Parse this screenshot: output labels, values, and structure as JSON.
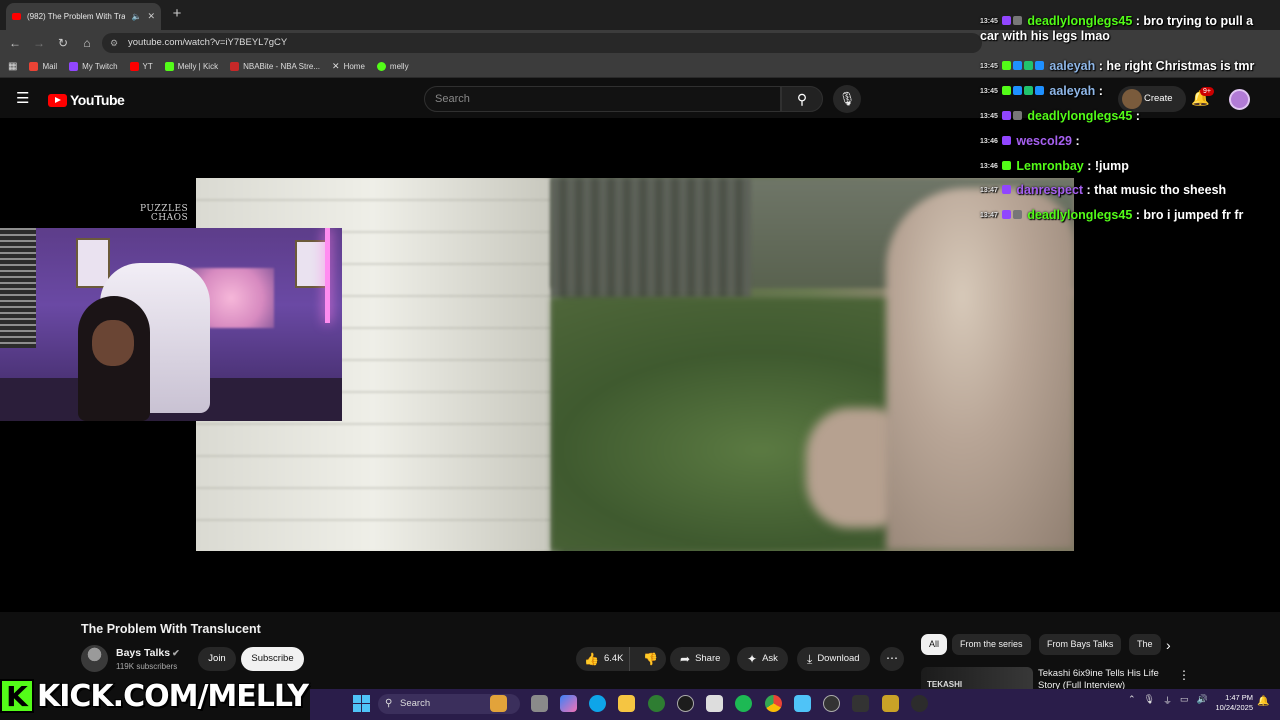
{
  "browser": {
    "tab_title": "(982) The Problem With Tra",
    "tab_muted_icon": "speaker-icon",
    "url": "youtube.com/watch?v=iY7BEYL7gCY",
    "bookmarks": [
      "Mail",
      "My Twitch",
      "YT",
      "Melly | Kick",
      "NBABite - NBA Stre...",
      "Home",
      "melly"
    ]
  },
  "youtube": {
    "logo": "YouTube",
    "search_placeholder": "Search",
    "create_label": "Create",
    "notif_badge": "9+"
  },
  "player": {
    "overlay_logo": "PUZZLES\nCHAOS"
  },
  "video": {
    "title": "The Problem With Translucent",
    "channel": "Bays Talks",
    "verified": "✔",
    "subscribers": "119K subscribers",
    "join_label": "Join",
    "subscribe_label": "Subscribe",
    "likes": "6.4K",
    "share_label": "Share",
    "ask_label": "Ask",
    "download_label": "Download"
  },
  "chips": [
    "All",
    "From the series",
    "From Bays Talks",
    "The"
  ],
  "recommendation": {
    "thumb_text": "TEKASHI",
    "title": "Tekashi 6ix9ine Tells His Life Story (Full Interview)"
  },
  "chat": [
    {
      "time": "13:45",
      "badges": [
        "twitch",
        "mute"
      ],
      "user": "deadlylonglegs45",
      "user_color": "#53fc18",
      "text": " : bro trying to pull a car with his legs lmao"
    },
    {
      "time": "13:45",
      "badges": [
        "kick",
        "blue",
        "green",
        "blue"
      ],
      "user": "aaleyah",
      "user_color": "#8fb7e8",
      "text": " : he right Christmas is tmr"
    },
    {
      "time": "13:45",
      "badges": [
        "kick",
        "blue",
        "green",
        "blue"
      ],
      "user": "aaleyah",
      "user_color": "#8fb7e8",
      "text": " :"
    },
    {
      "time": "13:45",
      "badges": [
        "twitch",
        "mute"
      ],
      "user": "deadlylonglegs45",
      "user_color": "#53fc18",
      "text": " :"
    },
    {
      "time": "13:46",
      "badges": [
        "twitch"
      ],
      "user": "wescol29",
      "user_color": "#a660f0",
      "text": " :"
    },
    {
      "time": "13:46",
      "badges": [
        "kick"
      ],
      "user": "Lemronbay",
      "user_color": "#53fc18",
      "text": " : !jump"
    },
    {
      "time": "13:47",
      "badges": [
        "twitch"
      ],
      "user": "danrespect",
      "user_color": "#a660f0",
      "text": " : that music tho sheesh"
    },
    {
      "time": "13:47",
      "badges": [
        "twitch",
        "mute"
      ],
      "user": "deadlylonglegs45",
      "user_color": "#53fc18",
      "text": " : bro i jumped fr fr"
    }
  ],
  "kick_overlay": "KICK.COM/MELLY",
  "taskbar": {
    "search_label": "Search",
    "time": "1:47 PM",
    "date": "10/24/2025"
  }
}
